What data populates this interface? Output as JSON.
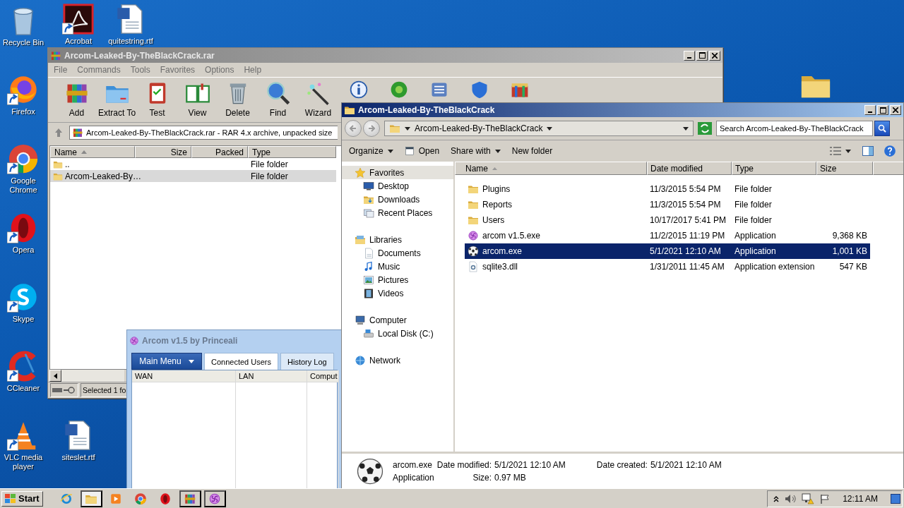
{
  "desktop": {
    "icons": [
      {
        "label": "Recycle Bin",
        "kind": "bin",
        "shortcut": false
      },
      {
        "label": "Acrobat",
        "kind": "pdf",
        "shortcut": true
      },
      {
        "label": "quitestring.rtf",
        "kind": "doc",
        "shortcut": false
      },
      {
        "label": "Firefox",
        "kind": "firefox",
        "shortcut": true
      },
      {
        "label": "Google Chrome",
        "kind": "chrome",
        "shortcut": true
      },
      {
        "label": "Opera",
        "kind": "opera",
        "shortcut": true
      },
      {
        "label": "Skype",
        "kind": "skype",
        "shortcut": true
      },
      {
        "label": "CCleaner",
        "kind": "ccleaner",
        "shortcut": true
      },
      {
        "label": "VLC media player",
        "kind": "vlc",
        "shortcut": true
      },
      {
        "label": "siteslet.rtf",
        "kind": "doc",
        "shortcut": false
      },
      {
        "kind": "folder",
        "shortcut": false
      }
    ]
  },
  "winrar": {
    "title": "Arcom-Leaked-By-TheBlackCrack.rar",
    "menu": [
      "File",
      "Commands",
      "Tools",
      "Favorites",
      "Options",
      "Help"
    ],
    "toolbar": [
      {
        "label": "Add",
        "kind": "add"
      },
      {
        "label": "Extract To",
        "kind": "extract"
      },
      {
        "label": "Test",
        "kind": "test"
      },
      {
        "label": "View",
        "kind": "view"
      },
      {
        "label": "Delete",
        "kind": "delete"
      },
      {
        "label": "Find",
        "kind": "find"
      },
      {
        "label": "Wizard",
        "kind": "wizard"
      },
      {
        "kind": "info"
      },
      {
        "kind": "virus"
      },
      {
        "kind": "comment"
      },
      {
        "kind": "protect"
      },
      {
        "kind": "sfx"
      }
    ],
    "path": "Arcom-Leaked-By-TheBlackCrack.rar - RAR 4.x archive, unpacked size",
    "columns": [
      "Name",
      "Size",
      "Packed",
      "Type"
    ],
    "rows": [
      {
        "name": "..",
        "type": "File folder",
        "selected": false
      },
      {
        "name": "Arcom-Leaked-By…",
        "type": "File folder",
        "selected": true
      }
    ],
    "status": "Selected 1 fo"
  },
  "arcom": {
    "title": "Arcom v1.5 by Princeali",
    "menu_button": "Main Menu",
    "tabs": [
      {
        "label": "Connected Users",
        "selected": true
      },
      {
        "label": "History Log",
        "selected": false
      }
    ],
    "columns": [
      "WAN",
      "LAN",
      "Comput"
    ]
  },
  "explorer": {
    "title": "Arcom-Leaked-By-TheBlackCrack",
    "breadcrumb": "Arcom-Leaked-By-TheBlackCrack",
    "search_placeholder": "Search Arcom-Leaked-By-TheBlackCrack",
    "commands": [
      {
        "label": "Organize",
        "kind": "menu"
      },
      {
        "label": "Open",
        "kind": "icon"
      },
      {
        "label": "Share with",
        "kind": "menu"
      },
      {
        "label": "New folder",
        "kind": "plain"
      }
    ],
    "nav": [
      {
        "label": "Favorites",
        "kind": "star",
        "selected": true,
        "children": [
          {
            "label": "Desktop",
            "kind": "desktop",
            "selected": false
          },
          {
            "label": "Downloads",
            "kind": "downloads",
            "selected": false
          },
          {
            "label": "Recent Places",
            "kind": "recent",
            "selected": false
          }
        ]
      },
      {
        "label": "Libraries",
        "kind": "libraries",
        "selected": false,
        "children": [
          {
            "label": "Documents",
            "kind": "documents",
            "selected": false
          },
          {
            "label": "Music",
            "kind": "music",
            "selected": false
          },
          {
            "label": "Pictures",
            "kind": "pictures",
            "selected": false
          },
          {
            "label": "Videos",
            "kind": "videos",
            "selected": false
          }
        ]
      },
      {
        "label": "Computer",
        "kind": "computer",
        "selected": false,
        "children": [
          {
            "label": "Local Disk (C:)",
            "kind": "disk",
            "selected": false
          }
        ]
      },
      {
        "label": "Network",
        "kind": "network",
        "selected": false
      }
    ],
    "columns": [
      "Name",
      "Date modified",
      "Type",
      "Size"
    ],
    "files": [
      {
        "name": "Plugins",
        "kind": "folder",
        "date": "11/3/2015 5:54 PM",
        "type": "File folder",
        "selected": false
      },
      {
        "name": "Reports",
        "kind": "folder",
        "date": "11/3/2015 5:54 PM",
        "type": "File folder",
        "selected": false
      },
      {
        "name": "Users",
        "kind": "folder",
        "date": "10/17/2017 5:41 PM",
        "type": "File folder",
        "selected": false
      },
      {
        "name": "arcom v1.5.exe",
        "kind": "exe",
        "date": "11/2/2015 11:19 PM",
        "type": "Application",
        "size": "9,368 KB",
        "selected": false
      },
      {
        "name": "arcom.exe",
        "kind": "ball",
        "date": "5/1/2021 12:10 AM",
        "type": "Application",
        "size": "1,001 KB",
        "selected": true
      },
      {
        "name": "sqlite3.dll",
        "kind": "dll",
        "date": "1/31/2011 11:45 AM",
        "type": "Application extension",
        "size": "547 KB",
        "selected": false
      }
    ],
    "details": {
      "name": "arcom.exe",
      "type": "Application",
      "modified_label": "Date modified:",
      "modified": "5/1/2021 12:10 AM",
      "created_label": "Date created:",
      "created": "5/1/2021 12:10 AM",
      "size_label": "Size:",
      "size": "0.97 MB"
    }
  },
  "taskbar": {
    "start": "Start",
    "apps": [
      {
        "kind": "ie",
        "open": false,
        "selected": false
      },
      {
        "kind": "folder",
        "open": true,
        "selected": true
      },
      {
        "kind": "media",
        "open": false,
        "selected": false
      },
      {
        "kind": "chrome",
        "open": false,
        "selected": false
      },
      {
        "kind": "opera",
        "open": false,
        "selected": false
      },
      {
        "kind": "add",
        "open": true,
        "selected": false
      },
      {
        "kind": "exe",
        "open": true,
        "selected": false
      }
    ],
    "clock": "12:11 AM"
  }
}
